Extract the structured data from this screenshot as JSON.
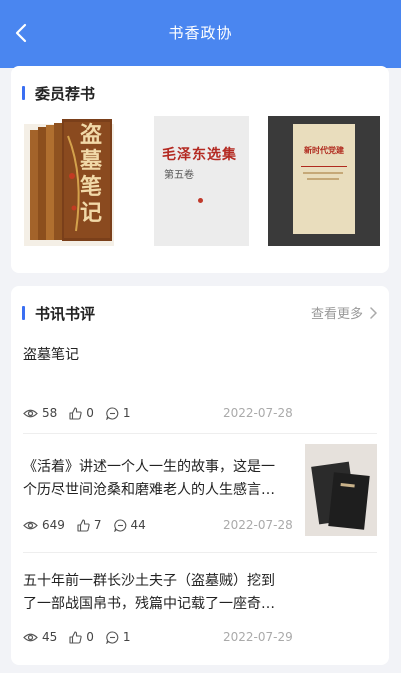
{
  "header": {
    "title": "书香政协"
  },
  "recommend": {
    "title": "委员荐书",
    "books": [
      {
        "name": "盗墓笔记",
        "cover_text": "盗墓笔记"
      },
      {
        "name": "毛泽东选集",
        "cover_text": "毛泽东选集",
        "cover_sub": "第五卷"
      },
      {
        "name": "新时代党建",
        "cover_text": "新时代党建"
      }
    ]
  },
  "reviews": {
    "title": "书讯书评",
    "more_label": "查看更多",
    "items": [
      {
        "title": "盗墓笔记",
        "views": "58",
        "likes": "0",
        "comments": "1",
        "date": "2022-07-28"
      },
      {
        "title_line1": "《活着》讲述一个人一生的故事，这是一",
        "title_line2": "个历尽世间沧桑和磨难老人的人生感言…",
        "views": "649",
        "likes": "7",
        "comments": "44",
        "date": "2022-07-28"
      },
      {
        "title_line1": "五十年前一群长沙土夫子（盗墓贼）挖到",
        "title_line2": "了一部战国帛书，残篇中记载了一座奇…",
        "views": "45",
        "likes": "0",
        "comments": "1",
        "date": "2022-07-29"
      }
    ]
  },
  "colors": {
    "accent": "#4a86f0",
    "section_bar": "#3b6ff2"
  }
}
